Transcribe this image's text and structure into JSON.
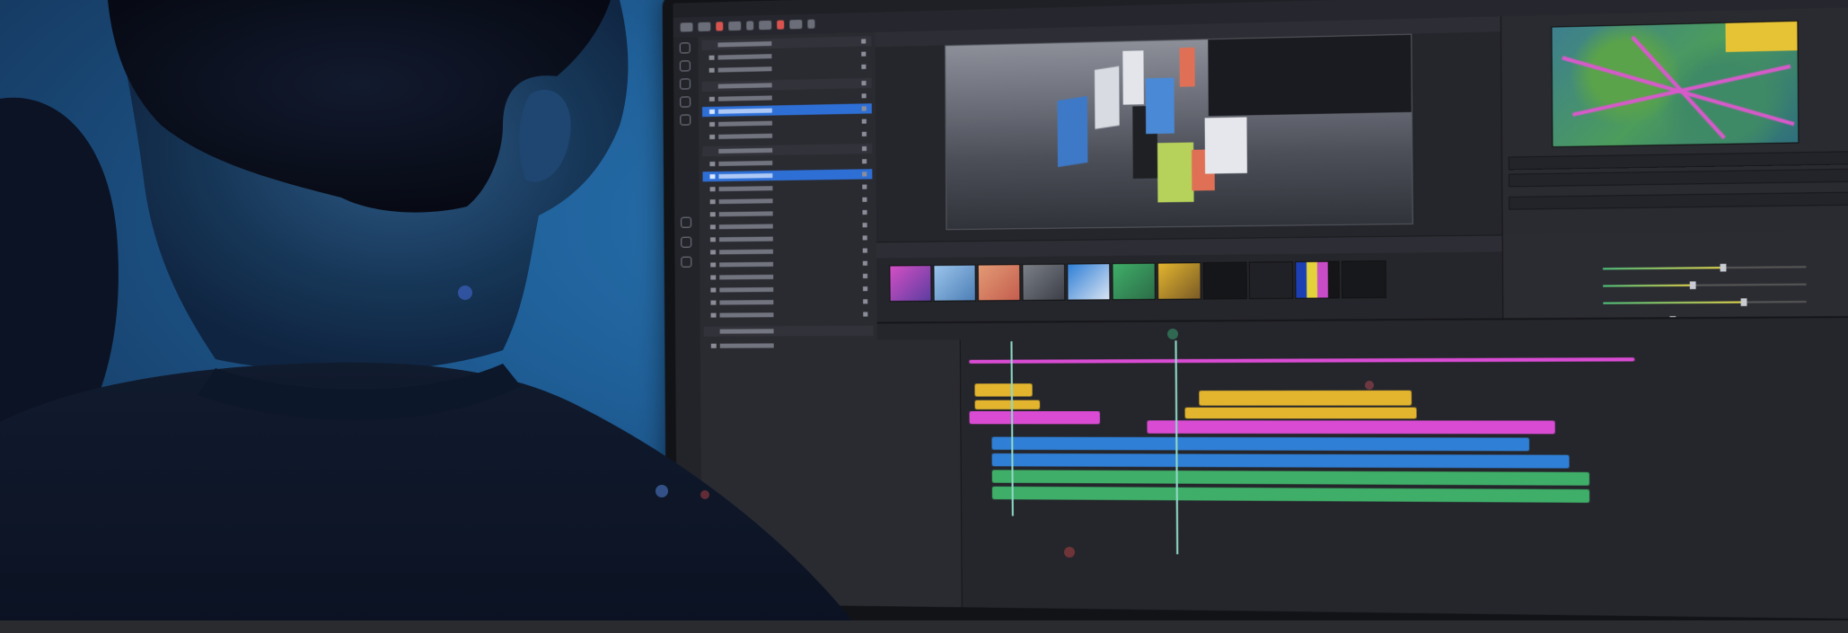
{
  "scene": {
    "description_colors": {
      "wall": "#1f5f98",
      "ui_accent_blue": "#2e6fd6",
      "clip_yellow": "#e3b52e",
      "clip_magenta": "#d94bd3",
      "clip_blue": "#2f7fd6",
      "clip_green": "#3fae68",
      "playhead": "#8fd8c6"
    }
  },
  "icons": [
    "monitor-icon",
    "play-icon",
    "settings-icon"
  ]
}
